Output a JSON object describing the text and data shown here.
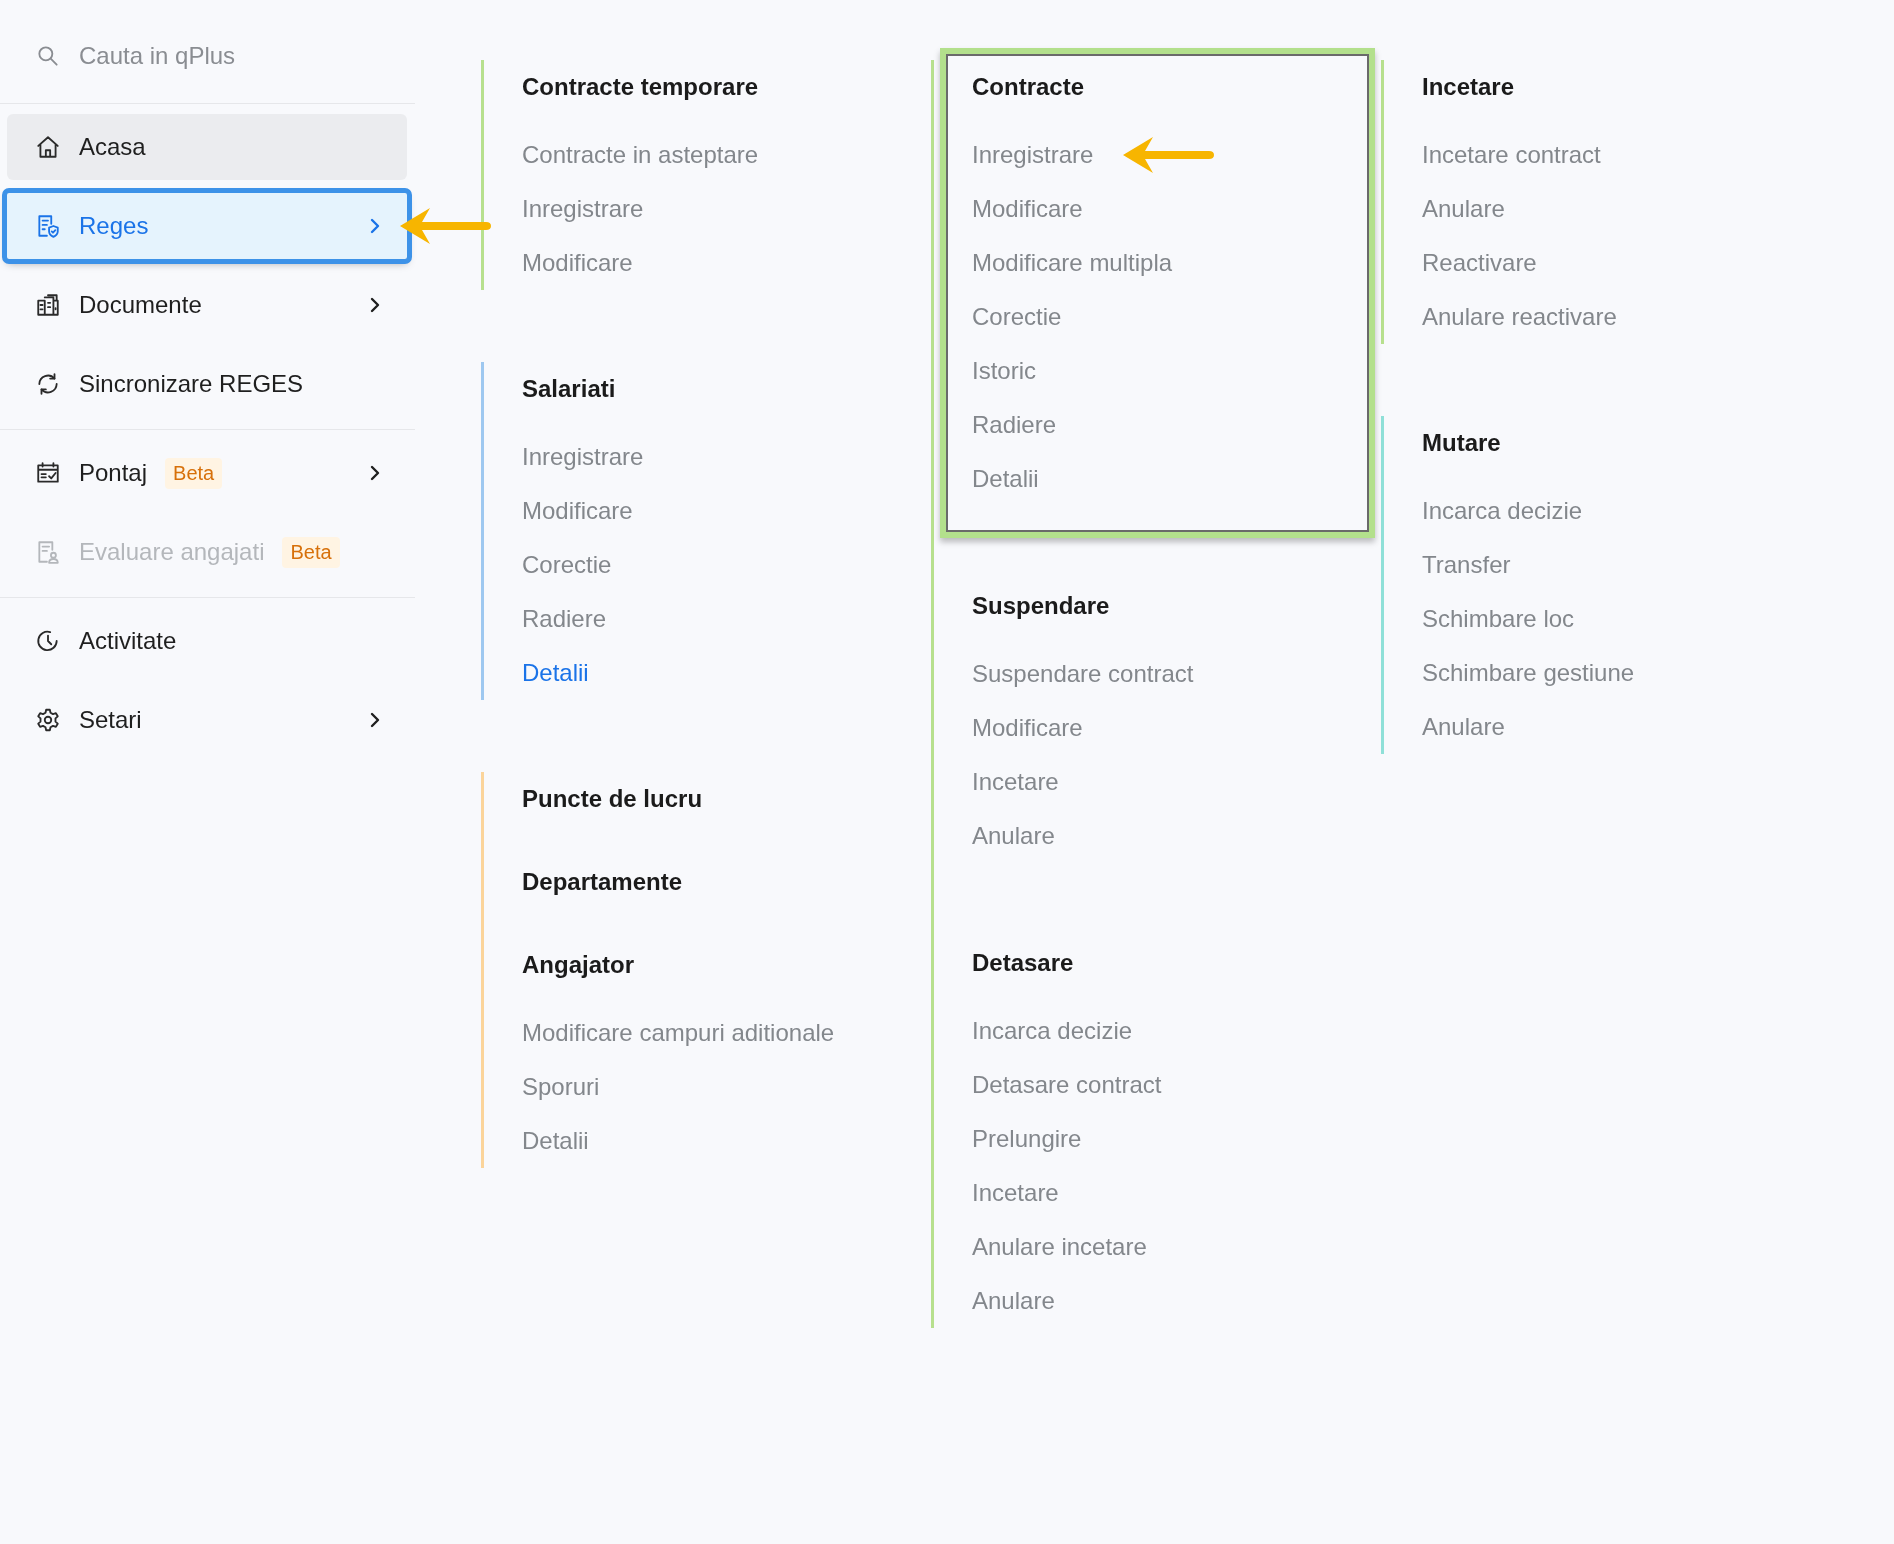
{
  "sidebar": {
    "search": {
      "placeholder": "Cauta in qPlus"
    },
    "sections": [
      [
        {
          "label": "Acasa",
          "selected": false,
          "hovered": true,
          "expandable": false,
          "disabled": false,
          "highlighted": false,
          "pointer_arrow": false
        },
        {
          "label": "Reges",
          "selected": true,
          "hovered": false,
          "expandable": true,
          "disabled": false,
          "highlighted": true,
          "pointer_arrow": true
        },
        {
          "label": "Documente",
          "selected": false,
          "hovered": false,
          "expandable": true,
          "disabled": false,
          "highlighted": false,
          "pointer_arrow": false
        },
        {
          "label": "Sincronizare REGES",
          "selected": false,
          "hovered": false,
          "expandable": false,
          "disabled": false,
          "highlighted": false,
          "pointer_arrow": false
        }
      ],
      [
        {
          "label": "Pontaj",
          "badge": "Beta",
          "selected": false,
          "hovered": false,
          "expandable": true,
          "disabled": false,
          "highlighted": false,
          "pointer_arrow": false
        },
        {
          "label": "Evaluare angajati",
          "badge": "Beta",
          "selected": false,
          "hovered": false,
          "expandable": false,
          "disabled": true,
          "highlighted": false,
          "pointer_arrow": false
        }
      ],
      [
        {
          "label": "Activitate",
          "selected": false,
          "hovered": false,
          "expandable": false,
          "disabled": false,
          "highlighted": false,
          "pointer_arrow": false
        },
        {
          "label": "Setari",
          "selected": false,
          "hovered": false,
          "expandable": true,
          "disabled": false,
          "highlighted": false,
          "pointer_arrow": false
        }
      ]
    ]
  },
  "columns": [
    {
      "groups": [
        {
          "color": "#b7e08e",
          "sections": [
            {
              "heading": "Contracte temporare",
              "highlighted": false,
              "items": [
                {
                  "label": "Contracte in asteptare",
                  "active": false,
                  "pointer_arrow": false
                },
                {
                  "label": "Inregistrare",
                  "active": false,
                  "pointer_arrow": false
                },
                {
                  "label": "Modificare",
                  "active": false,
                  "pointer_arrow": false
                }
              ]
            }
          ]
        },
        {
          "color": "#9ec8f0",
          "sections": [
            {
              "heading": "Salariati",
              "highlighted": false,
              "items": [
                {
                  "label": "Inregistrare",
                  "active": false,
                  "pointer_arrow": false
                },
                {
                  "label": "Modificare",
                  "active": false,
                  "pointer_arrow": false
                },
                {
                  "label": "Corectie",
                  "active": false,
                  "pointer_arrow": false
                },
                {
                  "label": "Radiere",
                  "active": false,
                  "pointer_arrow": false
                },
                {
                  "label": "Detalii",
                  "active": true,
                  "pointer_arrow": false
                }
              ]
            }
          ]
        },
        {
          "color": "#fbd49a",
          "sections": [
            {
              "heading": "Puncte de lucru",
              "highlighted": false
            },
            {
              "heading": "Departamente",
              "highlighted": false
            },
            {
              "heading": "Angajator",
              "highlighted": false,
              "items": [
                {
                  "label": "Modificare campuri aditionale",
                  "active": false,
                  "pointer_arrow": false
                },
                {
                  "label": "Sporuri",
                  "active": false,
                  "pointer_arrow": false
                },
                {
                  "label": "Detalii",
                  "active": false,
                  "pointer_arrow": false
                }
              ]
            }
          ]
        }
      ]
    },
    {
      "groups": [
        {
          "color": "#b7e08e",
          "sections": [
            {
              "heading": "Contracte",
              "highlighted": true,
              "items": [
                {
                  "label": "Inregistrare",
                  "active": false,
                  "pointer_arrow": true
                },
                {
                  "label": "Modificare",
                  "active": false,
                  "pointer_arrow": false
                },
                {
                  "label": "Modificare multipla",
                  "active": false,
                  "pointer_arrow": false
                },
                {
                  "label": "Corectie",
                  "active": false,
                  "pointer_arrow": false
                },
                {
                  "label": "Istoric",
                  "active": false,
                  "pointer_arrow": false
                },
                {
                  "label": "Radiere",
                  "active": false,
                  "pointer_arrow": false
                },
                {
                  "label": "Detalii",
                  "active": false,
                  "pointer_arrow": false
                }
              ]
            },
            {
              "heading": "Suspendare",
              "highlighted": false,
              "items": [
                {
                  "label": "Suspendare contract",
                  "active": false,
                  "pointer_arrow": false
                },
                {
                  "label": "Modificare",
                  "active": false,
                  "pointer_arrow": false
                },
                {
                  "label": "Incetare",
                  "active": false,
                  "pointer_arrow": false
                },
                {
                  "label": "Anulare",
                  "active": false,
                  "pointer_arrow": false
                }
              ]
            },
            {
              "heading": "Detasare",
              "highlighted": false,
              "items": [
                {
                  "label": "Incarca decizie",
                  "active": false,
                  "pointer_arrow": false
                },
                {
                  "label": "Detasare contract",
                  "active": false,
                  "pointer_arrow": false
                },
                {
                  "label": "Prelungire",
                  "active": false,
                  "pointer_arrow": false
                },
                {
                  "label": "Incetare",
                  "active": false,
                  "pointer_arrow": false
                },
                {
                  "label": "Anulare incetare",
                  "active": false,
                  "pointer_arrow": false
                },
                {
                  "label": "Anulare",
                  "active": false,
                  "pointer_arrow": false
                }
              ]
            }
          ]
        }
      ]
    },
    {
      "groups": [
        {
          "color": "#b7e08e",
          "sections": [
            {
              "heading": "Incetare",
              "highlighted": false,
              "items": [
                {
                  "label": "Incetare contract",
                  "active": false,
                  "pointer_arrow": false
                },
                {
                  "label": "Anulare",
                  "active": false,
                  "pointer_arrow": false
                },
                {
                  "label": "Reactivare",
                  "active": false,
                  "pointer_arrow": false
                },
                {
                  "label": "Anulare reactivare",
                  "active": false,
                  "pointer_arrow": false
                }
              ]
            }
          ]
        },
        {
          "color": "#8fe0d8",
          "sections": [
            {
              "heading": "Mutare",
              "highlighted": false,
              "items": [
                {
                  "label": "Incarca decizie",
                  "active": false,
                  "pointer_arrow": false
                },
                {
                  "label": "Transfer",
                  "active": false,
                  "pointer_arrow": false
                },
                {
                  "label": "Schimbare loc",
                  "active": false,
                  "pointer_arrow": false
                },
                {
                  "label": "Schimbare gestiune",
                  "active": false,
                  "pointer_arrow": false
                },
                {
                  "label": "Anulare",
                  "active": false,
                  "pointer_arrow": false
                }
              ]
            }
          ]
        }
      ]
    }
  ]
}
